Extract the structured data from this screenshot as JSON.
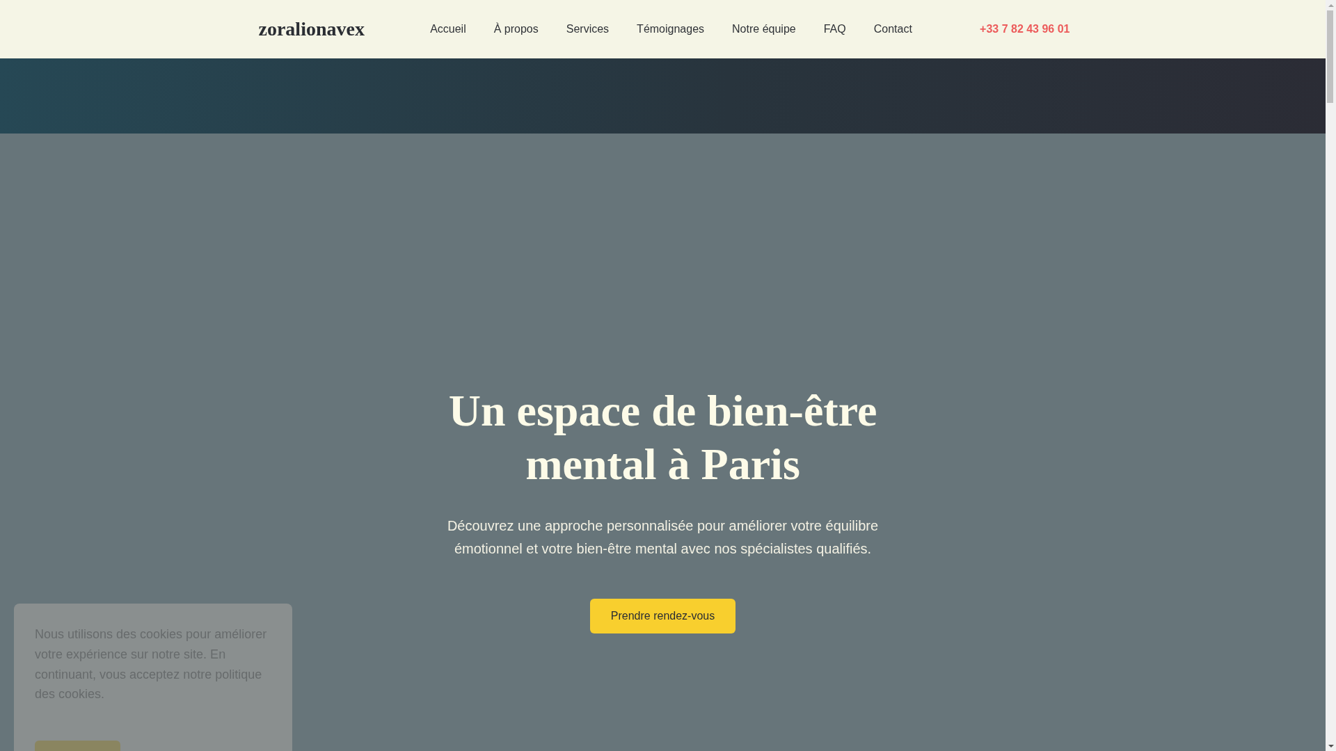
{
  "header": {
    "logo": "zoralionavex",
    "nav": [
      "Accueil",
      "À propos",
      "Services",
      "Témoignages",
      "Notre équipe",
      "FAQ",
      "Contact"
    ],
    "phone": "+33 7 82 43 96 01"
  },
  "hero": {
    "title": "Un espace de bien-être mental à Paris",
    "text": "Découvrez une approche personnalisée pour améliorer votre équilibre émotionnel et votre bien-être mental avec nos spécialistes qualifiés.",
    "button": "Prendre rendez-vous"
  },
  "cookie_banner": {
    "text": "Nous utilisons des cookies pour améliorer votre expérience sur notre site. En continuant, vous acceptez notre politique des cookies."
  }
}
